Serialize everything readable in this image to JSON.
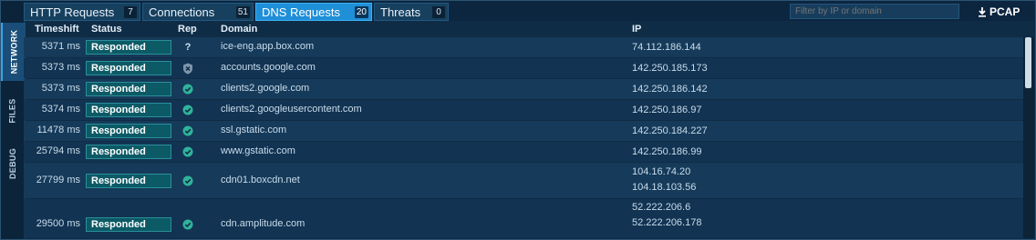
{
  "sidebar": {
    "tabs": [
      {
        "label": "NETWORK",
        "active": true
      },
      {
        "label": "FILES",
        "active": false
      },
      {
        "label": "DEBUG",
        "active": false
      }
    ]
  },
  "tabs": [
    {
      "label": "HTTP Requests",
      "count": "7",
      "active": false
    },
    {
      "label": "Connections",
      "count": "51",
      "active": false
    },
    {
      "label": "DNS Requests",
      "count": "20",
      "active": true
    },
    {
      "label": "Threats",
      "count": "0",
      "active": false
    }
  ],
  "filter": {
    "placeholder": "Filter by IP or domain"
  },
  "pcap": {
    "label": "PCAP",
    "icon": "download-icon"
  },
  "columns": {
    "timeshift": "Timeshift",
    "status": "Status",
    "rep": "Rep",
    "domain": "Domain",
    "ip": "IP"
  },
  "rows": [
    {
      "timeshift": "5371 ms",
      "status": "Responded",
      "rep": "unknown",
      "rep_text": "?",
      "domain": "ice-eng.app.box.com",
      "ips": [
        "74.112.186.144"
      ]
    },
    {
      "timeshift": "5373 ms",
      "status": "Responded",
      "rep": "shield",
      "rep_text": "",
      "domain": "accounts.google.com",
      "ips": [
        "142.250.185.173"
      ]
    },
    {
      "timeshift": "5373 ms",
      "status": "Responded",
      "rep": "safe",
      "rep_text": "",
      "domain": "clients2.google.com",
      "ips": [
        "142.250.186.142"
      ]
    },
    {
      "timeshift": "5374 ms",
      "status": "Responded",
      "rep": "safe",
      "rep_text": "",
      "domain": "clients2.googleusercontent.com",
      "ips": [
        "142.250.186.97"
      ]
    },
    {
      "timeshift": "11478 ms",
      "status": "Responded",
      "rep": "safe",
      "rep_text": "",
      "domain": "ssl.gstatic.com",
      "ips": [
        "142.250.184.227"
      ]
    },
    {
      "timeshift": "25794 ms",
      "status": "Responded",
      "rep": "safe",
      "rep_text": "",
      "domain": "www.gstatic.com",
      "ips": [
        "142.250.186.99"
      ]
    },
    {
      "timeshift": "27799 ms",
      "status": "Responded",
      "rep": "safe",
      "rep_text": "",
      "domain": "cdn01.boxcdn.net",
      "ips": [
        "104.16.74.20",
        "104.18.103.56"
      ]
    },
    {
      "timeshift": "29500 ms",
      "status": "Responded",
      "rep": "safe",
      "rep_text": "",
      "domain": "cdn.amplitude.com",
      "ips": [
        "52.222.206.6",
        "52.222.206.178"
      ]
    }
  ],
  "colors": {
    "active_tab": "#1f8fd8",
    "status_bg": "#0c5a66",
    "safe": "#2fb39b"
  }
}
